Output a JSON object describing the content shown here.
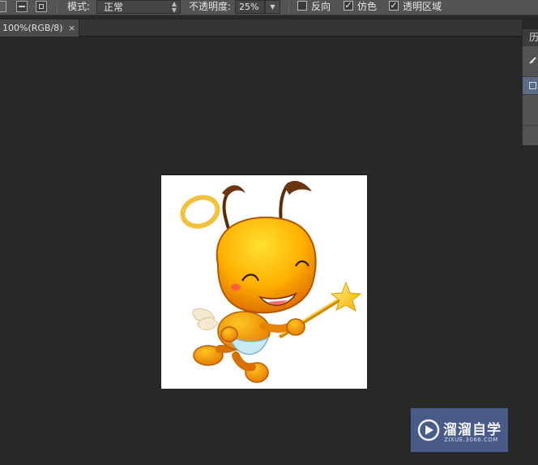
{
  "options_bar": {
    "mode_label": "模式:",
    "mode_value": "正常",
    "opacity_label": "不透明度:",
    "opacity_value": "25%",
    "reverse_label": "反向",
    "reverse_checked": false,
    "dither_label": "仿色",
    "dither_checked": true,
    "transparency_label": "透明区域",
    "transparency_checked": true
  },
  "document_tab": {
    "title": "100%(RGB/8)",
    "close_glyph": "×"
  },
  "right_panel": {
    "header_label": "历"
  },
  "watermark": {
    "brand": "溜溜自学",
    "url": "ZIXUE.3066.COM",
    "color": "#4b5f8f"
  },
  "canvas": {
    "image_subject": "cartoon-angel-ant",
    "background": "#ffffff"
  }
}
